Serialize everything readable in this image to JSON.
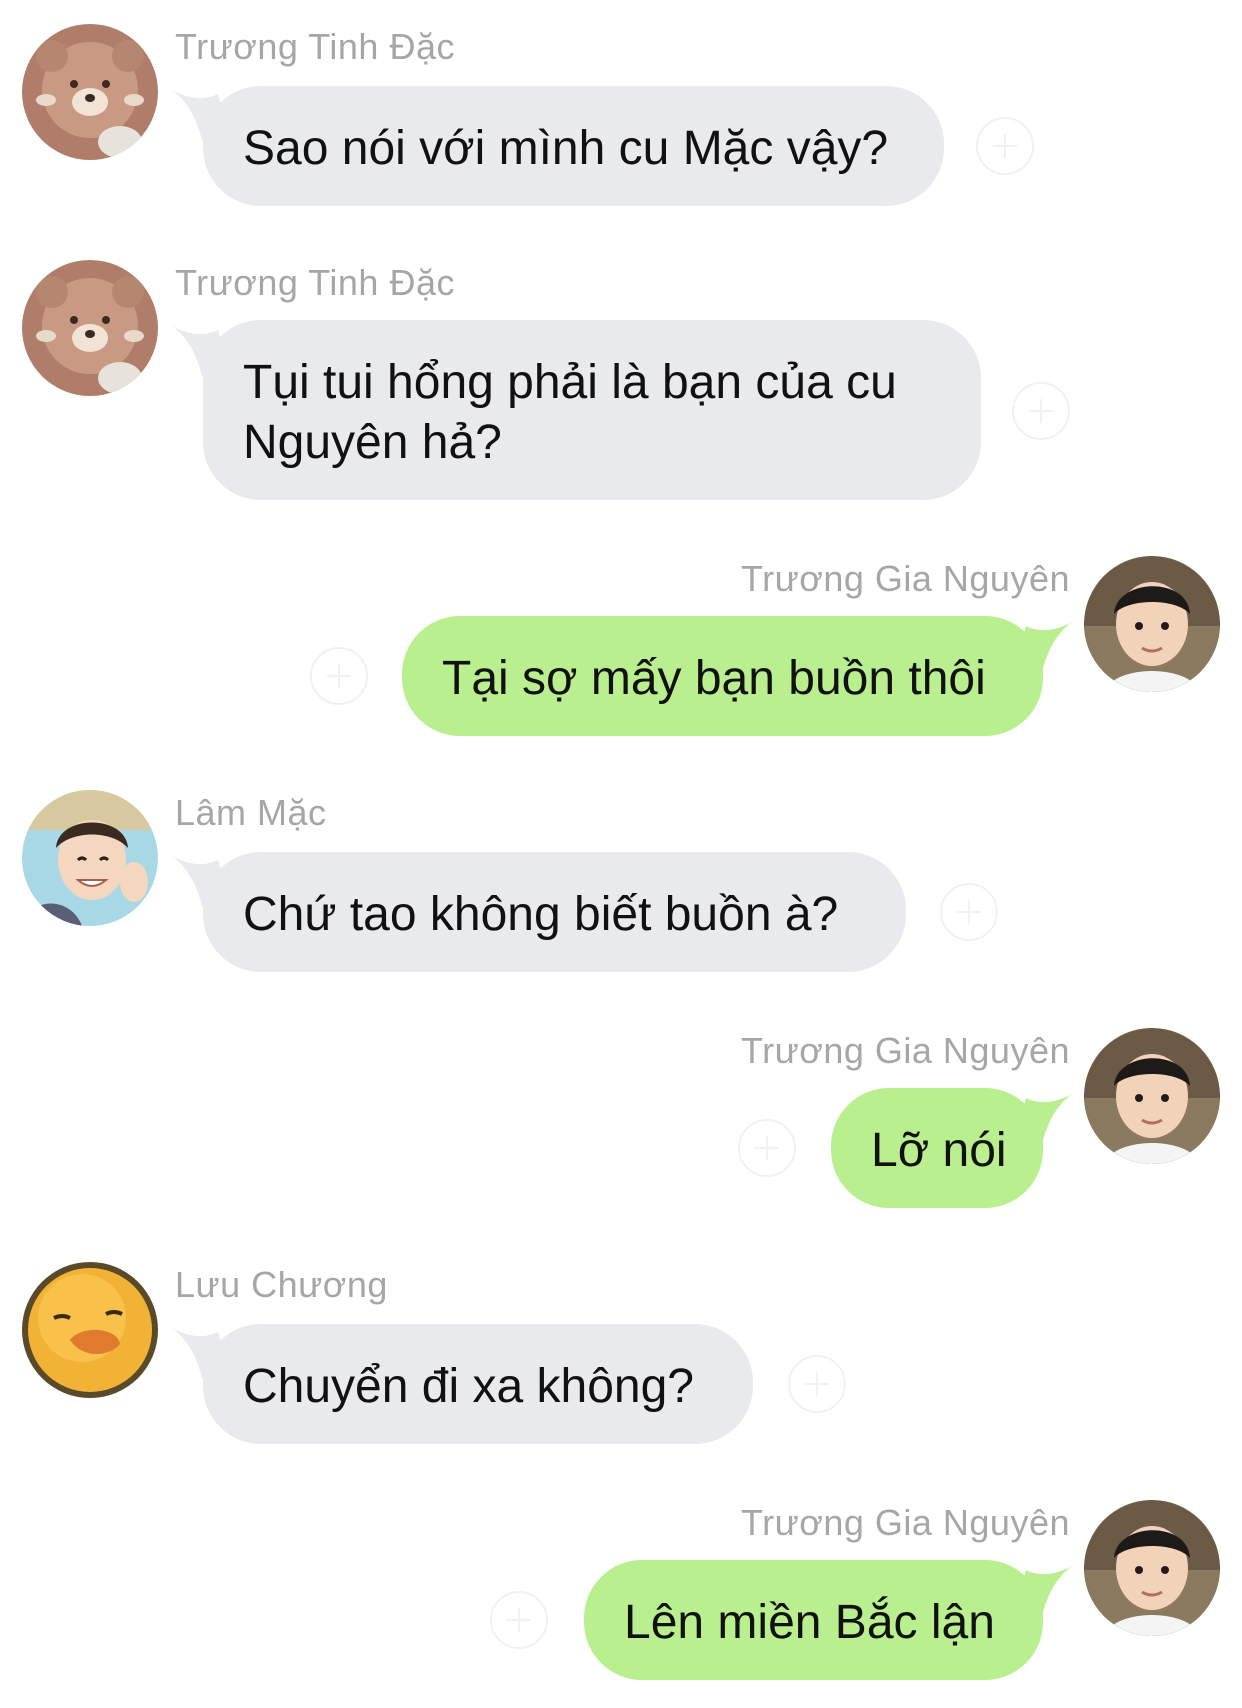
{
  "messages": [
    {
      "sender": "Trương Tinh Đặc",
      "text": "Sao nói với mình cu Mặc vậy?",
      "avatar_icon": "bear-plush-avatar-icon",
      "side": "in"
    },
    {
      "sender": "Trương Tinh Đặc",
      "text": "Tụi tui hổng phải là bạn của cu Nguyên hả?",
      "avatar_icon": "bear-plush-avatar-icon",
      "side": "in"
    },
    {
      "sender": "Trương Gia Nguyên",
      "text": "Tại sợ mấy bạn buồn thôi",
      "avatar_icon": "boy-photo-avatar-icon",
      "side": "out"
    },
    {
      "sender": "Lâm Mặc",
      "text": "Chứ tao không biết buồn à?",
      "avatar_icon": "boy-waving-avatar-icon",
      "side": "in"
    },
    {
      "sender": "Trương Gia Nguyên",
      "text": "Lỡ nói",
      "avatar_icon": "boy-photo-avatar-icon",
      "side": "out"
    },
    {
      "sender": "Lưu Chương",
      "text": "Chuyển đi xa không?",
      "avatar_icon": "duck-avatar-icon",
      "side": "in"
    },
    {
      "sender": "Trương Gia Nguyên",
      "text": "Lên miền Bắc lận",
      "avatar_icon": "boy-photo-avatar-icon",
      "side": "out"
    }
  ],
  "colors": {
    "incoming_bubble": "#e9eaed",
    "outgoing_bubble": "#b9ef8e",
    "sender_name": "#a6a6a6",
    "message_text": "#111111",
    "background": "#ffffff"
  }
}
